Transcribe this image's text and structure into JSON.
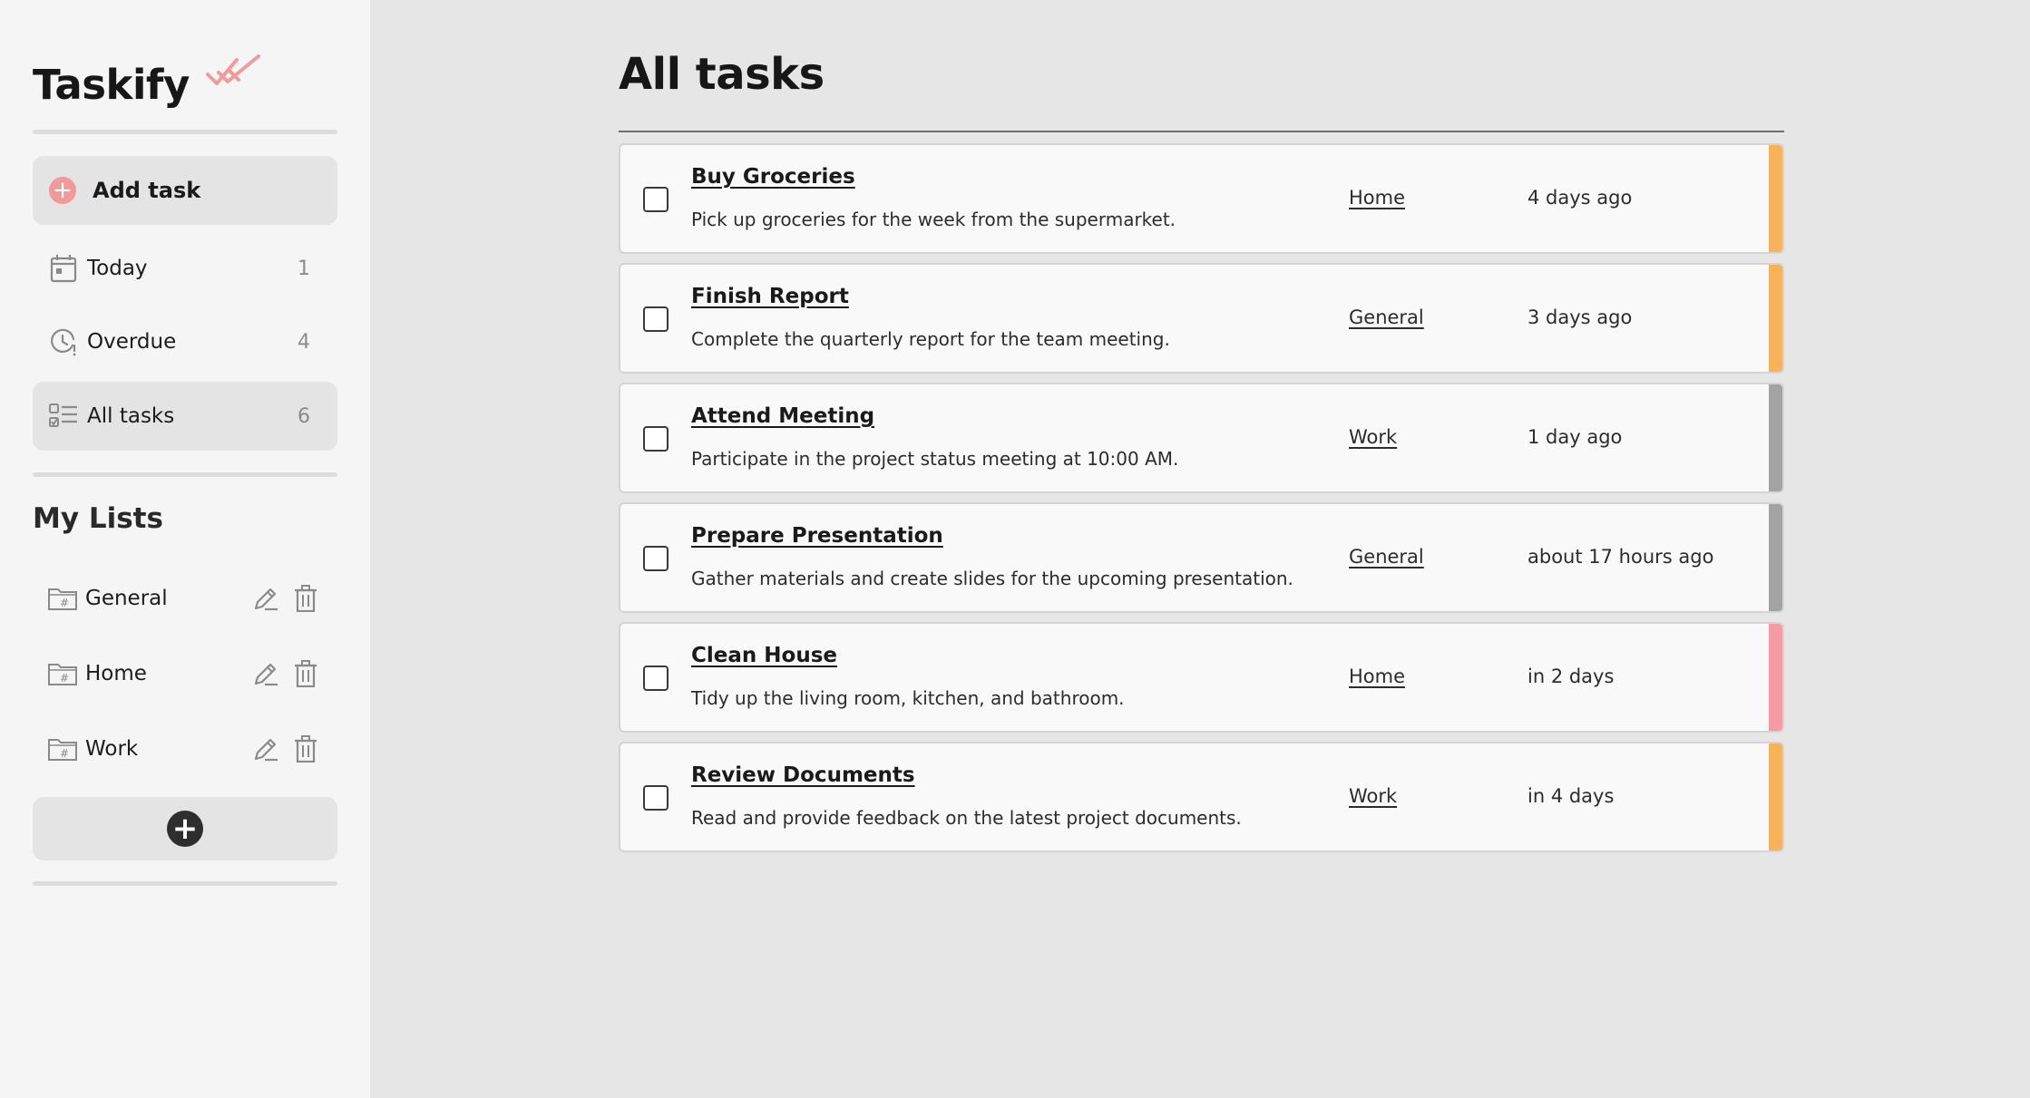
{
  "app": {
    "name": "Taskify"
  },
  "sidebar": {
    "add_task_label": "Add task",
    "nav": [
      {
        "label": "Today",
        "count": "1",
        "icon": "calendar-icon"
      },
      {
        "label": "Overdue",
        "count": "4",
        "icon": "clock-alert-icon"
      },
      {
        "label": "All tasks",
        "count": "6",
        "icon": "checklist-icon",
        "active": true
      }
    ],
    "lists_title": "My Lists",
    "lists": [
      {
        "label": "General",
        "icon": "folder-hash-icon"
      },
      {
        "label": "Home",
        "icon": "folder-hash-icon"
      },
      {
        "label": "Work",
        "icon": "folder-hash-icon"
      }
    ]
  },
  "main": {
    "title": "All tasks",
    "tasks": [
      {
        "title": "Buy Groceries",
        "description": "Pick up groceries for the week from the supermarket.",
        "list": "Home",
        "date": "4 days ago",
        "priority_color": "#f7b35c"
      },
      {
        "title": "Finish Report",
        "description": "Complete the quarterly report for the team meeting.",
        "list": "General",
        "date": "3 days ago",
        "priority_color": "#f7b35c"
      },
      {
        "title": "Attend Meeting",
        "description": "Participate in the project status meeting at 10:00 AM.",
        "list": "Work",
        "date": "1 day ago",
        "priority_color": "#a3a3a3"
      },
      {
        "title": "Prepare Presentation",
        "description": "Gather materials and create slides for the upcoming presentation.",
        "list": "General",
        "date": "about 17 hours ago",
        "priority_color": "#a3a3a3"
      },
      {
        "title": "Clean House",
        "description": "Tidy up the living room, kitchen, and bathroom.",
        "list": "Home",
        "date": "in 2 days",
        "priority_color": "#f59ba3"
      },
      {
        "title": "Review Documents",
        "description": "Read and provide feedback on the latest project documents.",
        "list": "Work",
        "date": "in 4 days",
        "priority_color": "#f7b35c"
      }
    ]
  },
  "colors": {
    "accent": "#f19a9b",
    "sidebar_bg": "#f5f5f5",
    "main_bg": "#e6e6e6"
  }
}
